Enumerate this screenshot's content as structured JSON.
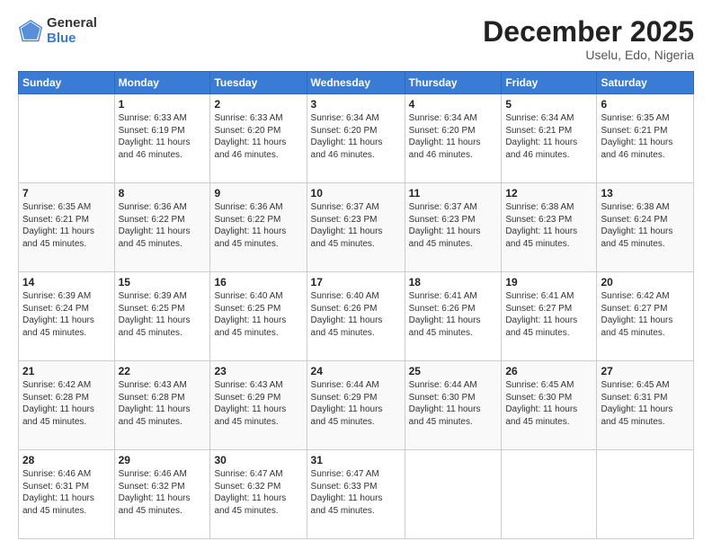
{
  "logo": {
    "general": "General",
    "blue": "Blue"
  },
  "title": "December 2025",
  "subtitle": "Uselu, Edo, Nigeria",
  "days_header": [
    "Sunday",
    "Monday",
    "Tuesday",
    "Wednesday",
    "Thursday",
    "Friday",
    "Saturday"
  ],
  "weeks": [
    [
      {
        "day": "",
        "info": ""
      },
      {
        "day": "1",
        "info": "Sunrise: 6:33 AM\nSunset: 6:19 PM\nDaylight: 11 hours\nand 46 minutes."
      },
      {
        "day": "2",
        "info": "Sunrise: 6:33 AM\nSunset: 6:20 PM\nDaylight: 11 hours\nand 46 minutes."
      },
      {
        "day": "3",
        "info": "Sunrise: 6:34 AM\nSunset: 6:20 PM\nDaylight: 11 hours\nand 46 minutes."
      },
      {
        "day": "4",
        "info": "Sunrise: 6:34 AM\nSunset: 6:20 PM\nDaylight: 11 hours\nand 46 minutes."
      },
      {
        "day": "5",
        "info": "Sunrise: 6:34 AM\nSunset: 6:21 PM\nDaylight: 11 hours\nand 46 minutes."
      },
      {
        "day": "6",
        "info": "Sunrise: 6:35 AM\nSunset: 6:21 PM\nDaylight: 11 hours\nand 46 minutes."
      }
    ],
    [
      {
        "day": "7",
        "info": "Sunrise: 6:35 AM\nSunset: 6:21 PM\nDaylight: 11 hours\nand 45 minutes."
      },
      {
        "day": "8",
        "info": "Sunrise: 6:36 AM\nSunset: 6:22 PM\nDaylight: 11 hours\nand 45 minutes."
      },
      {
        "day": "9",
        "info": "Sunrise: 6:36 AM\nSunset: 6:22 PM\nDaylight: 11 hours\nand 45 minutes."
      },
      {
        "day": "10",
        "info": "Sunrise: 6:37 AM\nSunset: 6:23 PM\nDaylight: 11 hours\nand 45 minutes."
      },
      {
        "day": "11",
        "info": "Sunrise: 6:37 AM\nSunset: 6:23 PM\nDaylight: 11 hours\nand 45 minutes."
      },
      {
        "day": "12",
        "info": "Sunrise: 6:38 AM\nSunset: 6:23 PM\nDaylight: 11 hours\nand 45 minutes."
      },
      {
        "day": "13",
        "info": "Sunrise: 6:38 AM\nSunset: 6:24 PM\nDaylight: 11 hours\nand 45 minutes."
      }
    ],
    [
      {
        "day": "14",
        "info": "Sunrise: 6:39 AM\nSunset: 6:24 PM\nDaylight: 11 hours\nand 45 minutes."
      },
      {
        "day": "15",
        "info": "Sunrise: 6:39 AM\nSunset: 6:25 PM\nDaylight: 11 hours\nand 45 minutes."
      },
      {
        "day": "16",
        "info": "Sunrise: 6:40 AM\nSunset: 6:25 PM\nDaylight: 11 hours\nand 45 minutes."
      },
      {
        "day": "17",
        "info": "Sunrise: 6:40 AM\nSunset: 6:26 PM\nDaylight: 11 hours\nand 45 minutes."
      },
      {
        "day": "18",
        "info": "Sunrise: 6:41 AM\nSunset: 6:26 PM\nDaylight: 11 hours\nand 45 minutes."
      },
      {
        "day": "19",
        "info": "Sunrise: 6:41 AM\nSunset: 6:27 PM\nDaylight: 11 hours\nand 45 minutes."
      },
      {
        "day": "20",
        "info": "Sunrise: 6:42 AM\nSunset: 6:27 PM\nDaylight: 11 hours\nand 45 minutes."
      }
    ],
    [
      {
        "day": "21",
        "info": "Sunrise: 6:42 AM\nSunset: 6:28 PM\nDaylight: 11 hours\nand 45 minutes."
      },
      {
        "day": "22",
        "info": "Sunrise: 6:43 AM\nSunset: 6:28 PM\nDaylight: 11 hours\nand 45 minutes."
      },
      {
        "day": "23",
        "info": "Sunrise: 6:43 AM\nSunset: 6:29 PM\nDaylight: 11 hours\nand 45 minutes."
      },
      {
        "day": "24",
        "info": "Sunrise: 6:44 AM\nSunset: 6:29 PM\nDaylight: 11 hours\nand 45 minutes."
      },
      {
        "day": "25",
        "info": "Sunrise: 6:44 AM\nSunset: 6:30 PM\nDaylight: 11 hours\nand 45 minutes."
      },
      {
        "day": "26",
        "info": "Sunrise: 6:45 AM\nSunset: 6:30 PM\nDaylight: 11 hours\nand 45 minutes."
      },
      {
        "day": "27",
        "info": "Sunrise: 6:45 AM\nSunset: 6:31 PM\nDaylight: 11 hours\nand 45 minutes."
      }
    ],
    [
      {
        "day": "28",
        "info": "Sunrise: 6:46 AM\nSunset: 6:31 PM\nDaylight: 11 hours\nand 45 minutes."
      },
      {
        "day": "29",
        "info": "Sunrise: 6:46 AM\nSunset: 6:32 PM\nDaylight: 11 hours\nand 45 minutes."
      },
      {
        "day": "30",
        "info": "Sunrise: 6:47 AM\nSunset: 6:32 PM\nDaylight: 11 hours\nand 45 minutes."
      },
      {
        "day": "31",
        "info": "Sunrise: 6:47 AM\nSunset: 6:33 PM\nDaylight: 11 hours\nand 45 minutes."
      },
      {
        "day": "",
        "info": ""
      },
      {
        "day": "",
        "info": ""
      },
      {
        "day": "",
        "info": ""
      }
    ]
  ]
}
